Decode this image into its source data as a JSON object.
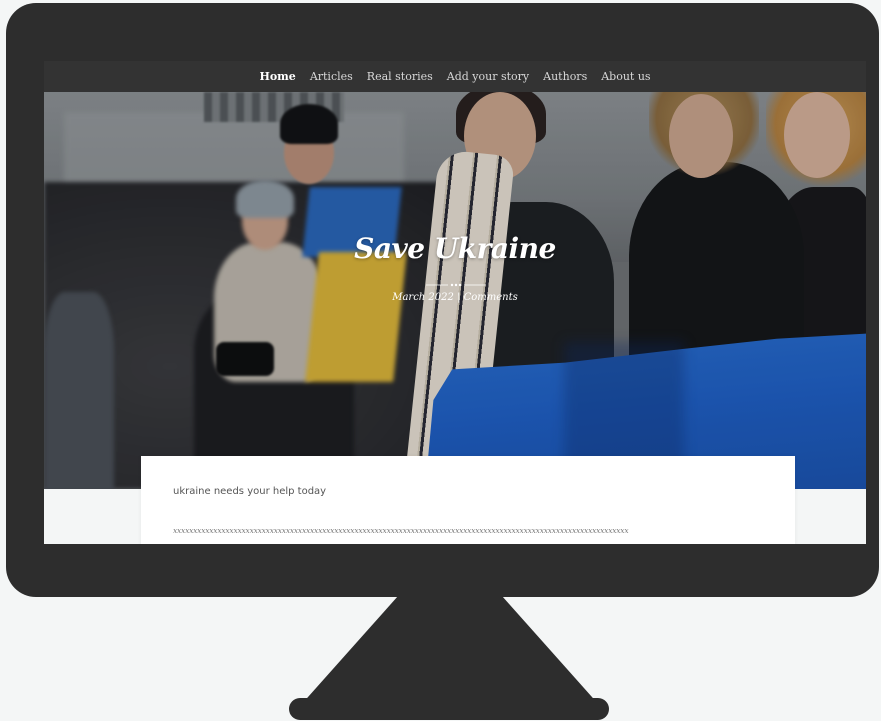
{
  "nav": {
    "items": [
      {
        "label": "Home",
        "active": true
      },
      {
        "label": "Articles",
        "active": false
      },
      {
        "label": "Real stories",
        "active": false
      },
      {
        "label": "Add your story",
        "active": false
      },
      {
        "label": "Authors",
        "active": false
      },
      {
        "label": "About us",
        "active": false
      }
    ]
  },
  "hero": {
    "title": "Save Ukraine",
    "date": "March 2022",
    "separator": "|",
    "comments_label": "Comments"
  },
  "content": {
    "lead": "ukraine needs your help today",
    "filler": "xxxxxxxxxxxxxxxxxxxxxxxxxxxxxxxxxxxxxxxxxxxxxxxxxxxxxxxxxxxxxxxxxxxxxxxxxxxxxxxxxxxxxxxxxxxxxxxxxxxxxxxxxxxxxxxxx"
  },
  "colors": {
    "frame": "#2d2d2d",
    "navbar": "#333333",
    "flag_blue": "#1f5fc4",
    "flag_yellow": "#d9b33a",
    "page_bg": "#f4f6f6"
  }
}
